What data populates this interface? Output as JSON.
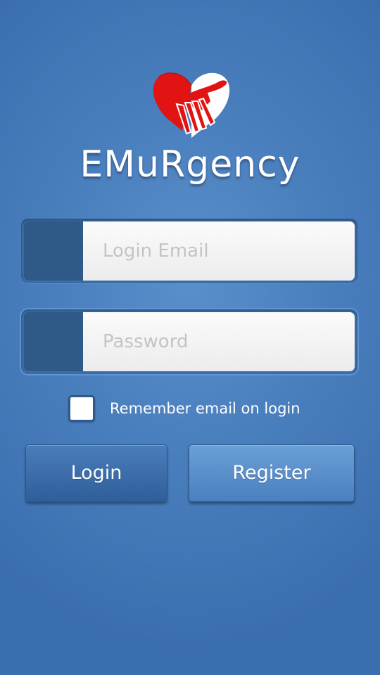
{
  "app": {
    "title": "EMuRgency"
  },
  "login_form": {
    "email_placeholder": "Login Email",
    "password_placeholder": "Password",
    "remember_label": "Remember email on login",
    "remember_checked": false,
    "login_label": "Login",
    "register_label": "Register"
  },
  "colors": {
    "background": "#4a7fbe",
    "logo_red": "#e11313",
    "field_icon_box": "#2f5a88"
  },
  "icons": {
    "logo": "heart-hand-logo-icon"
  }
}
